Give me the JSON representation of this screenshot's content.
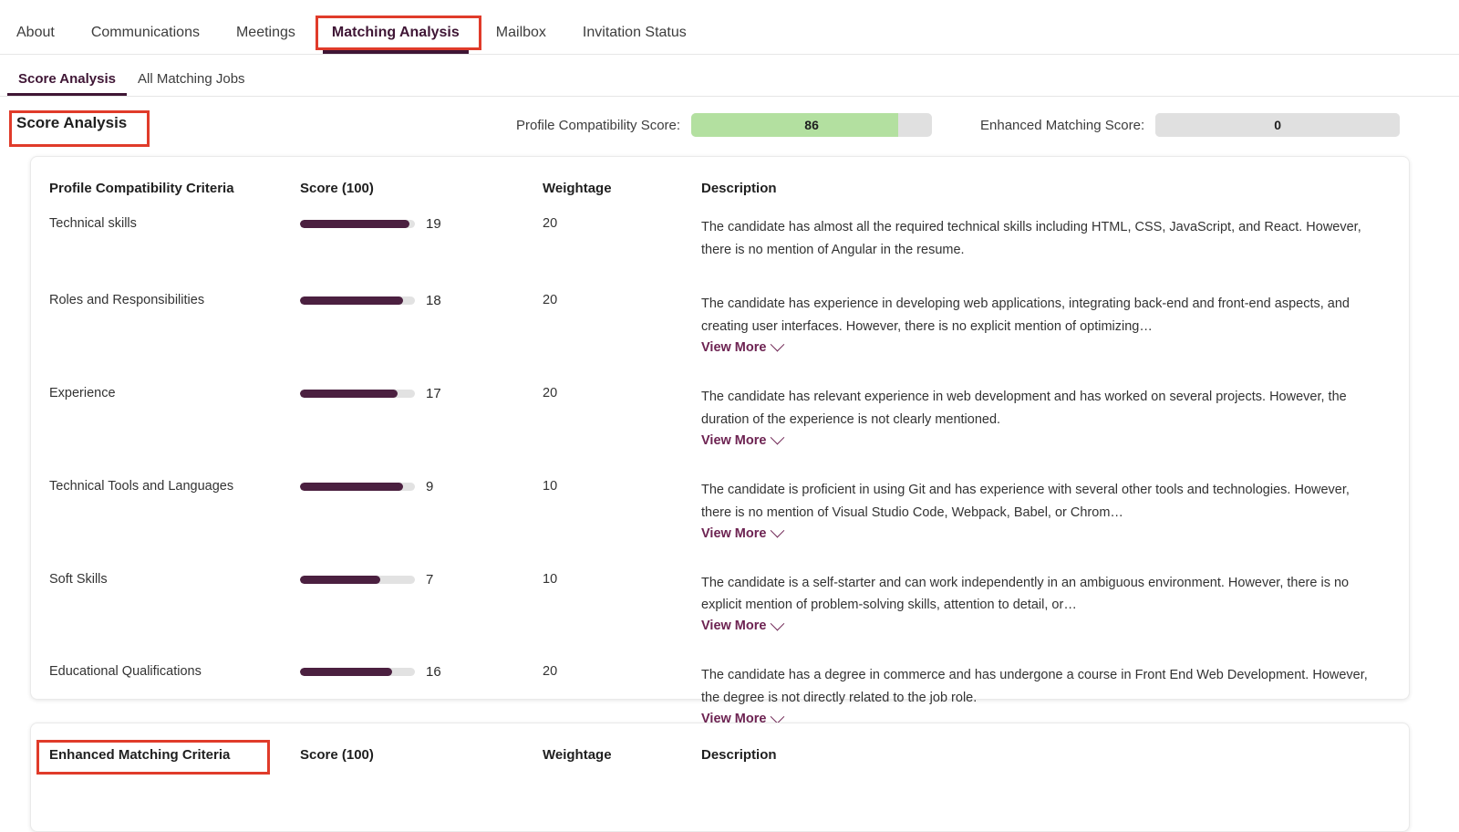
{
  "topnav": {
    "items": [
      {
        "label": "About",
        "active": false
      },
      {
        "label": "Communications",
        "active": false
      },
      {
        "label": "Meetings",
        "active": false
      },
      {
        "label": "Matching Analysis",
        "active": true
      },
      {
        "label": "Mailbox",
        "active": false
      },
      {
        "label": "Invitation Status",
        "active": false
      }
    ]
  },
  "subnav": {
    "items": [
      {
        "label": "Score Analysis",
        "active": true
      },
      {
        "label": "All Matching Jobs",
        "active": false
      }
    ]
  },
  "score_header": {
    "heading": "Score Analysis",
    "profile": {
      "label": "Profile Compatibility Score:",
      "value": "86",
      "fill_percent": 86,
      "fill_color": "#b3e0a0",
      "track_color": "#e0e0e0"
    },
    "enhanced": {
      "label": "Enhanced Matching Score:",
      "value": "0",
      "fill_percent": 0,
      "fill_color": "#e0e0e0",
      "track_color": "#e0e0e0"
    }
  },
  "profile_table": {
    "headers": {
      "criteria": "Profile Compatibility Criteria",
      "score": "Score (100)",
      "weightage": "Weightage",
      "description": "Description"
    },
    "rows": [
      {
        "criteria": "Technical skills",
        "score": "19",
        "fill_percent": 95,
        "weightage": "20",
        "description": "The candidate has almost all the required technical skills including HTML, CSS, JavaScript, and React. However, there is no mention of Angular in the resume.",
        "view_more": "",
        "has_view_more": false
      },
      {
        "criteria": "Roles and Responsibilities",
        "score": "18",
        "fill_percent": 90,
        "weightage": "20",
        "description": "The candidate has experience in developing web applications, integrating back-end and front-end aspects, and creating user interfaces. However, there is no explicit mention of optimizing…",
        "view_more": "View More",
        "has_view_more": true
      },
      {
        "criteria": "Experience",
        "score": "17",
        "fill_percent": 85,
        "weightage": "20",
        "description": "The candidate has relevant experience in web development and has worked on several projects. However, the duration of the experience is not clearly mentioned.",
        "view_more": "View More",
        "has_view_more": true
      },
      {
        "criteria": "Technical Tools and Languages",
        "score": "9",
        "fill_percent": 90,
        "weightage": "10",
        "description": "The candidate is proficient in using Git and has experience with several other tools and technologies. However, there is no mention of Visual Studio Code, Webpack, Babel, or Chrom…",
        "view_more": "View More",
        "has_view_more": true
      },
      {
        "criteria": "Soft Skills",
        "score": "7",
        "fill_percent": 70,
        "weightage": "10",
        "description": "The candidate is a self-starter and can work independently in an ambiguous environment. However, there is no explicit mention of problem-solving skills, attention to detail, or…",
        "view_more": "View More",
        "has_view_more": true
      },
      {
        "criteria": "Educational Qualifications",
        "score": "16",
        "fill_percent": 80,
        "weightage": "20",
        "description": "The candidate has a degree in commerce and has undergone a course in Front End Web Development. However, the degree is not directly related to the job role.",
        "view_more": "View More",
        "has_view_more": true
      }
    ]
  },
  "enhanced_table": {
    "headers": {
      "criteria": "Enhanced Matching Criteria",
      "score": "Score (100)",
      "weightage": "Weightage",
      "description": "Description"
    },
    "rows": []
  },
  "highlights": {
    "color": "#e03b2a",
    "boxes": [
      "matching-analysis-tab",
      "score-analysis-heading",
      "enhanced-matching-criteria-header"
    ]
  },
  "theme": {
    "accent": "#3f1635",
    "link": "#6d2352",
    "bar": "#4b2040"
  }
}
